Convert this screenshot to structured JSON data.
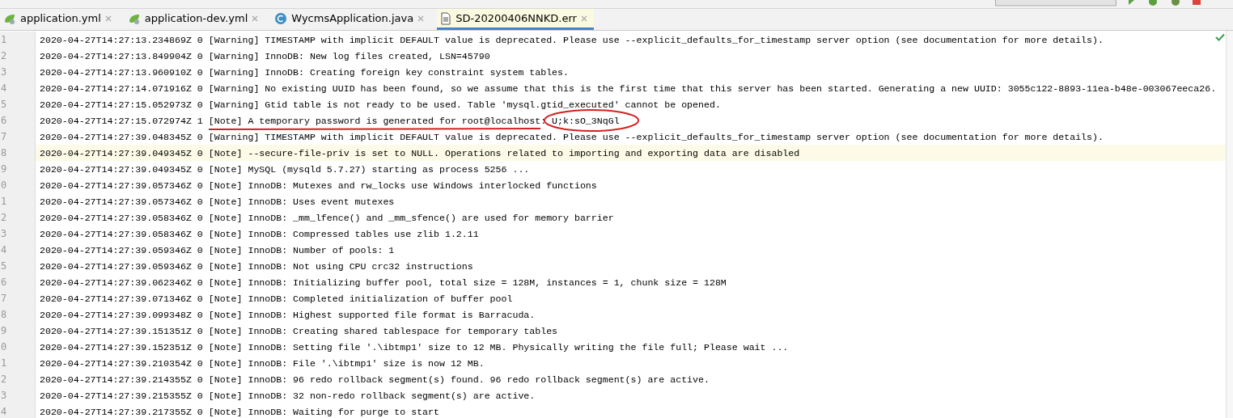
{
  "tabs": [
    {
      "label": "application.yml",
      "kind": "yml",
      "selected": false
    },
    {
      "label": "application-dev.yml",
      "kind": "yml",
      "selected": false
    },
    {
      "label": "WycmsApplication.java",
      "kind": "java",
      "selected": false
    },
    {
      "label": "SD-20200406NNKD.err",
      "kind": "err",
      "selected": true
    }
  ],
  "lines": [
    {
      "number": "1",
      "text": "2020-04-27T14:27:13.234869Z 0 [Warning] TIMESTAMP with implicit DEFAULT value is deprecated. Please use --explicit_defaults_for_timestamp server option (see documentation for more details).",
      "current": false
    },
    {
      "number": "2",
      "text": "2020-04-27T14:27:13.849904Z 0 [Warning] InnoDB: New log files created, LSN=45790",
      "current": false
    },
    {
      "number": "3",
      "text": "2020-04-27T14:27:13.960910Z 0 [Warning] InnoDB: Creating foreign key constraint system tables.",
      "current": false
    },
    {
      "number": "4",
      "text": "2020-04-27T14:27:14.071916Z 0 [Warning] No existing UUID has been found, so we assume that this is the first time that this server has been started. Generating a new UUID: 3055c122-8893-11ea-b48e-003067eeca26.",
      "current": false
    },
    {
      "number": "5",
      "text": "2020-04-27T14:27:15.052973Z 0 [Warning] Gtid table is not ready to be used. Table 'mysql.gtid_executed' cannot be opened.",
      "current": false
    },
    {
      "number": "6",
      "text": "2020-04-27T14:27:15.072974Z 1 [Note] A temporary password is generated for root@localhost: U;k:sO_3NqGl",
      "current": false
    },
    {
      "number": "7",
      "text": "2020-04-27T14:27:39.048345Z 0 [Warning] TIMESTAMP with implicit DEFAULT value is deprecated. Please use --explicit_defaults_for_timestamp server option (see documentation for more details).",
      "current": false
    },
    {
      "number": "8",
      "text": "2020-04-27T14:27:39.049345Z 0 [Note] --secure-file-priv is set to NULL. Operations related to importing and exporting data are disabled",
      "current": true
    },
    {
      "number": "9",
      "text": "2020-04-27T14:27:39.049345Z 0 [Note] MySQL (mysqld 5.7.27) starting as process 5256 ...",
      "current": false
    },
    {
      "number": "0",
      "text": "2020-04-27T14:27:39.057346Z 0 [Note] InnoDB: Mutexes and rw_locks use Windows interlocked functions",
      "current": false
    },
    {
      "number": "1",
      "text": "2020-04-27T14:27:39.057346Z 0 [Note] InnoDB: Uses event mutexes",
      "current": false
    },
    {
      "number": "2",
      "text": "2020-04-27T14:27:39.058346Z 0 [Note] InnoDB: _mm_lfence() and _mm_sfence() are used for memory barrier",
      "current": false
    },
    {
      "number": "3",
      "text": "2020-04-27T14:27:39.058346Z 0 [Note] InnoDB: Compressed tables use zlib 1.2.11",
      "current": false
    },
    {
      "number": "4",
      "text": "2020-04-27T14:27:39.059346Z 0 [Note] InnoDB: Number of pools: 1",
      "current": false
    },
    {
      "number": "5",
      "text": "2020-04-27T14:27:39.059346Z 0 [Note] InnoDB: Not using CPU crc32 instructions",
      "current": false
    },
    {
      "number": "6",
      "text": "2020-04-27T14:27:39.062346Z 0 [Note] InnoDB: Initializing buffer pool, total size = 128M, instances = 1, chunk size = 128M",
      "current": false
    },
    {
      "number": "7",
      "text": "2020-04-27T14:27:39.071346Z 0 [Note] InnoDB: Completed initialization of buffer pool",
      "current": false
    },
    {
      "number": "8",
      "text": "2020-04-27T14:27:39.099348Z 0 [Note] InnoDB: Highest supported file format is Barracuda.",
      "current": false
    },
    {
      "number": "9",
      "text": "2020-04-27T14:27:39.151351Z 0 [Note] InnoDB: Creating shared tablespace for temporary tables",
      "current": false
    },
    {
      "number": "0",
      "text": "2020-04-27T14:27:39.152351Z 0 [Note] InnoDB: Setting file '.\\ibtmp1' size to 12 MB. Physically writing the file full; Please wait ...",
      "current": false
    },
    {
      "number": "1",
      "text": "2020-04-27T14:27:39.210354Z 0 [Note] InnoDB: File '.\\ibtmp1' size is now 12 MB.",
      "current": false
    },
    {
      "number": "2",
      "text": "2020-04-27T14:27:39.214355Z 0 [Note] InnoDB: 96 redo rollback segment(s) found. 96 redo rollback segment(s) are active.",
      "current": false
    },
    {
      "number": "3",
      "text": "2020-04-27T14:27:39.215355Z 0 [Note] InnoDB: 32 non-redo rollback segment(s) are active.",
      "current": false
    },
    {
      "number": "4",
      "text": "2020-04-27T14:27:39.217355Z 0 [Note] InnoDB: Waiting for purge to start",
      "current": false
    }
  ]
}
